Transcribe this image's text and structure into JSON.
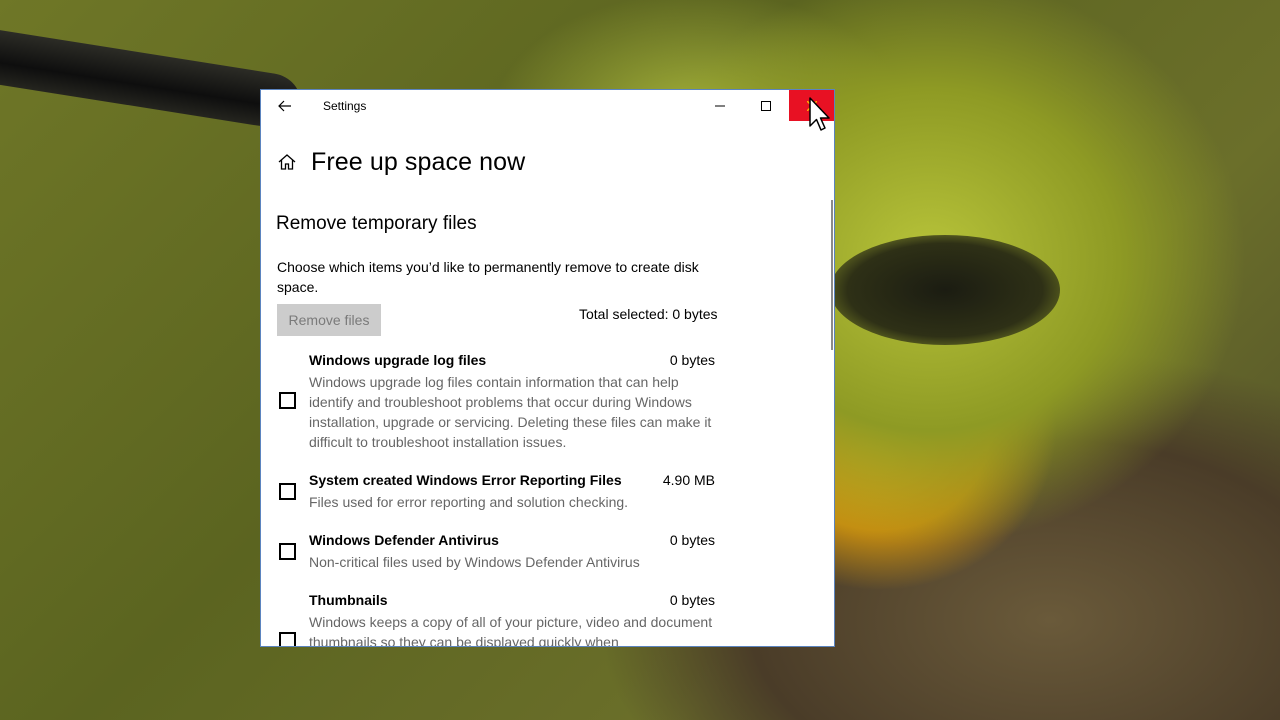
{
  "window": {
    "title": "Settings"
  },
  "page": {
    "title": "Free up space now"
  },
  "section": {
    "title": "Remove temporary files",
    "description": "Choose which items you’d like to permanently remove to create disk space.",
    "remove_button": "Remove files",
    "total_selected": "Total selected: 0 bytes"
  },
  "items": [
    {
      "name": "Windows upgrade log files",
      "size": "0 bytes",
      "description": "Windows upgrade log files contain information that can help identify and troubleshoot problems that occur during Windows installation, upgrade or servicing. Deleting these files can make it difficult to troubleshoot installation issues.",
      "checked": false
    },
    {
      "name": "System created Windows Error Reporting Files",
      "size": "4.90 MB",
      "description": "Files used for error reporting and solution checking.",
      "checked": false
    },
    {
      "name": "Windows Defender Antivirus",
      "size": "0 bytes",
      "description": "Non-critical files used by Windows Defender Antivirus",
      "checked": false
    },
    {
      "name": "Thumbnails",
      "size": "0 bytes",
      "description": "Windows keeps a copy of all of your picture, video and document thumbnails so they can be displayed quickly when",
      "checked": false
    }
  ],
  "icons": {
    "back": "back-arrow-icon",
    "home": "home-icon",
    "minimize": "minimize-icon",
    "maximize": "maximize-icon",
    "close": "close-icon",
    "cursor": "mouse-pointer-icon"
  },
  "colors": {
    "close_hover": "#e81123",
    "window_border": "#5b84bf",
    "disabled_button": "#cccccc",
    "secondary_text": "#666666"
  }
}
